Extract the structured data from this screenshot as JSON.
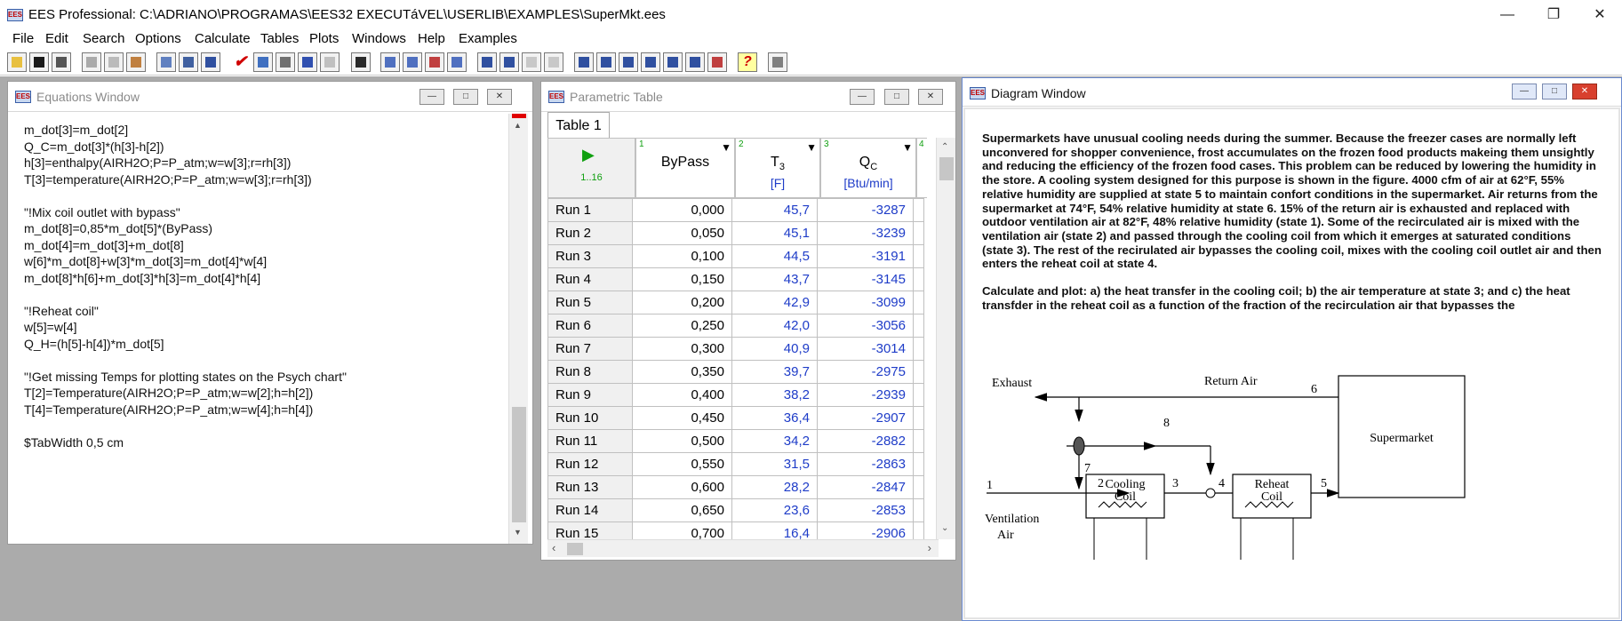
{
  "app": {
    "title": "EES Professional:  C:\\ADRIANO\\PROGRAMAS\\EES32 EXECUTáVEL\\USERLIB\\EXAMPLES\\SuperMkt.ees",
    "icon": "EES"
  },
  "menu": [
    "File",
    "Edit",
    "Search",
    "Options",
    "Calculate",
    "Tables",
    "Plots",
    "Windows",
    "Help",
    "Examples"
  ],
  "equations_window": {
    "title": "Equations Window",
    "lines": [
      "m_dot[3]=m_dot[2]",
      "Q_C=m_dot[3]*(h[3]-h[2])",
      "h[3]=enthalpy(AIRH2O;P=P_atm;w=w[3];r=rh[3])",
      "T[3]=temperature(AIRH2O;P=P_atm;w=w[3];r=rh[3])",
      "",
      "\"!Mix coil outlet with bypass\"",
      "m_dot[8]=0,85*m_dot[5]*(ByPass)",
      "m_dot[4]=m_dot[3]+m_dot[8]",
      "w[6]*m_dot[8]+w[3]*m_dot[3]=m_dot[4]*w[4]",
      "m_dot[8]*h[6]+m_dot[3]*h[3]=m_dot[4]*h[4]",
      "",
      "\"!Reheat coil\"",
      "w[5]=w[4]",
      "Q_H=(h[5]-h[4])*m_dot[5]",
      "",
      "\"!Get missing Temps for plotting states on the Psych chart\"",
      "T[2]=Temperature(AIRH2O;P=P_atm;w=w[2];h=h[2])",
      "T[4]=Temperature(AIRH2O;P=P_atm;w=w[4];h=h[4])",
      "",
      "$TabWidth 0,5 cm"
    ]
  },
  "parametric_table": {
    "title": "Parametric Table",
    "tab": "Table 1",
    "range_label": "1..16",
    "columns": [
      {
        "num": "1",
        "name": "ByPass",
        "unit": ""
      },
      {
        "num": "2",
        "name": "T",
        "sub": "3",
        "unit": "[F]"
      },
      {
        "num": "3",
        "name": "Q",
        "sub": "C",
        "unit": "[Btu/min]"
      },
      {
        "num": "4"
      }
    ],
    "rows": [
      {
        "run": "Run 1",
        "bypass": "0,000",
        "t3": "45,7",
        "qc": "-3287"
      },
      {
        "run": "Run 2",
        "bypass": "0,050",
        "t3": "45,1",
        "qc": "-3239"
      },
      {
        "run": "Run 3",
        "bypass": "0,100",
        "t3": "44,5",
        "qc": "-3191"
      },
      {
        "run": "Run 4",
        "bypass": "0,150",
        "t3": "43,7",
        "qc": "-3145"
      },
      {
        "run": "Run 5",
        "bypass": "0,200",
        "t3": "42,9",
        "qc": "-3099"
      },
      {
        "run": "Run 6",
        "bypass": "0,250",
        "t3": "42,0",
        "qc": "-3056"
      },
      {
        "run": "Run 7",
        "bypass": "0,300",
        "t3": "40,9",
        "qc": "-3014"
      },
      {
        "run": "Run 8",
        "bypass": "0,350",
        "t3": "39,7",
        "qc": "-2975"
      },
      {
        "run": "Run 9",
        "bypass": "0,400",
        "t3": "38,2",
        "qc": "-2939"
      },
      {
        "run": "Run 10",
        "bypass": "0,450",
        "t3": "36,4",
        "qc": "-2907"
      },
      {
        "run": "Run 11",
        "bypass": "0,500",
        "t3": "34,2",
        "qc": "-2882"
      },
      {
        "run": "Run 12",
        "bypass": "0,550",
        "t3": "31,5",
        "qc": "-2863"
      },
      {
        "run": "Run 13",
        "bypass": "0,600",
        "t3": "28,2",
        "qc": "-2847"
      },
      {
        "run": "Run 14",
        "bypass": "0,650",
        "t3": "23,6",
        "qc": "-2853"
      },
      {
        "run": "Run 15",
        "bypass": "0,700",
        "t3": "16,4",
        "qc": "-2906"
      }
    ]
  },
  "diagram_window": {
    "title": "Diagram Window",
    "paragraph1": "Supermarkets have unusual cooling needs during the summer.  Because the freezer cases are normally left unconvered for shopper convenience, frost accumulates on the frozen food products makeing them unsightly and reducing the efficiency of the frozen food cases.  This problem can be reduced by lowering the humidity in the store.  A cooling system designed for this purpose is shown in the figure. 4000 cfm of air at 62°F, 55% relative humidity are supplied at state 5 to maintain confort conditions in the supermarket.  Air returns from the supermarket at 74°F, 54% relative humidity at state 6.  15% of the return air is exhausted and replaced with outdoor ventilation air at 82°F, 48% relative humidity (state 1). Some of the recirculated air is mixed with the ventilation air (state 2) and passed through the cooling coil from which it emerges at saturated conditions (state 3).  The rest of the recirulated air bypasses the cooling coil, mixes with the cooling coil outlet air and then enters the reheat coil at state 4.",
    "paragraph2": "Calculate and plot:  a)  the heat transfer in the cooling coil;  b) the air temperature at state 3;  and c) the heat transfder in the reheat coil as a function of the fraction of the recirculation air that bypasses the",
    "labels": {
      "exhaust": "Exhaust",
      "return_air": "Return Air",
      "ventilation": "Ventilation",
      "air": "Air",
      "supermarket": "Supermarket",
      "cooling": "Cooling",
      "reheat": "Reheat",
      "coil": "Coil",
      "s1": "1",
      "s2": "2",
      "s3": "3",
      "s4": "4",
      "s5": "5",
      "s6": "6",
      "s7": "7",
      "s8": "8"
    }
  }
}
